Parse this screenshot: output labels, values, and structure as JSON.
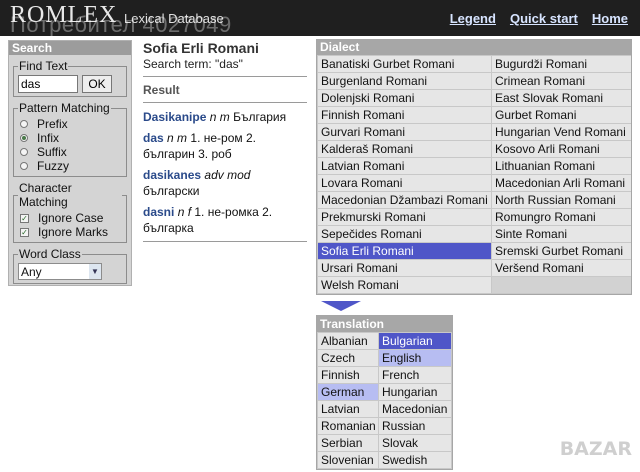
{
  "header": {
    "logo": "ROMLEX",
    "logo_sub": "Lexical Database",
    "watermark": "Потребител 4027049",
    "nav": [
      "Legend",
      "Quick start",
      "Home"
    ]
  },
  "search": {
    "title": "Search",
    "find_text_legend": "Find Text",
    "find_value": "das",
    "ok_label": "OK",
    "pattern_legend": "Pattern Matching",
    "patterns": [
      "Prefix",
      "Infix",
      "Suffix",
      "Fuzzy"
    ],
    "pattern_selected": "Infix",
    "char_legend": "Character Matching",
    "char_options": [
      "Ignore Case",
      "Ignore Marks"
    ],
    "word_class_legend": "Word Class",
    "word_class_value": "Any"
  },
  "result": {
    "title": "Sofia Erli Romani",
    "search_term": "Search term: \"das\"",
    "heading": "Result",
    "entries": [
      {
        "hw": "Dasikanipe",
        "pos": "n m",
        "gloss": "България"
      },
      {
        "hw": "das",
        "pos": "n m",
        "gloss": "1. не-ром 2. българин 3. роб"
      },
      {
        "hw": "dasikanes",
        "pos": "adv mod",
        "gloss": "български"
      },
      {
        "hw": "dasni",
        "pos": "n f",
        "gloss": "1. не-ромка 2. българка"
      }
    ]
  },
  "dialect": {
    "title": "Dialect",
    "items": [
      "Banatiski Gurbet Romani",
      "Bugurdži Romani",
      "Burgenland Romani",
      "Crimean Romani",
      "Dolenjski Romani",
      "East Slovak Romani",
      "Finnish Romani",
      "Gurbet Romani",
      "Gurvari Romani",
      "Hungarian Vend Romani",
      "Kalderaš Romani",
      "Kosovo Arli Romani",
      "Latvian Romani",
      "Lithuanian Romani",
      "Lovara Romani",
      "Macedonian Arli Romani",
      "Macedonian Džambazi Romani",
      "North Russian Romani",
      "Prekmurski Romani",
      "Romungro Romani",
      "Sepečides Romani",
      "Sinte Romani",
      "Sofia Erli Romani",
      "Sremski Gurbet Romani",
      "Ursari Romani",
      "Veršend Romani",
      "Welsh Romani",
      ""
    ],
    "selected": "Sofia Erli Romani"
  },
  "translation": {
    "title": "Translation",
    "items": [
      "Albanian",
      "Bulgarian",
      "Czech",
      "English",
      "Finnish",
      "French",
      "German",
      "Hungarian",
      "Latvian",
      "Macedonian",
      "Romanian",
      "Russian",
      "Serbian",
      "Slovak",
      "Slovenian",
      "Swedish"
    ],
    "selected": "Bulgarian",
    "highlighted": [
      "English",
      "German"
    ]
  },
  "corner_watermark": "BAZAR"
}
